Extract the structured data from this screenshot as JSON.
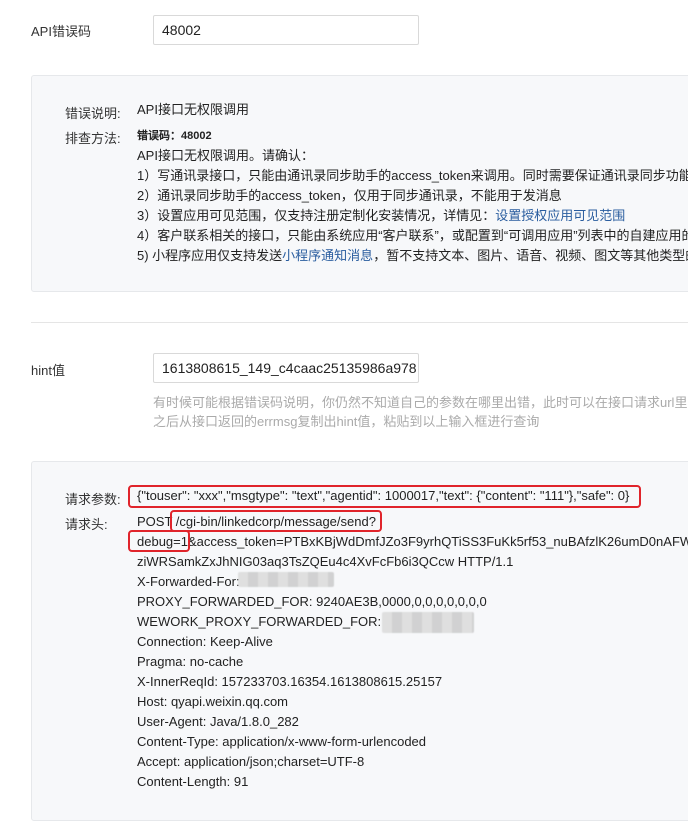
{
  "api_error": {
    "label": "API错误码",
    "value": "48002"
  },
  "error_panel": {
    "desc_label": "错误说明:",
    "desc_value": "API接口无权限调用",
    "check_label": "排查方法:",
    "code_line": "错误码：48002",
    "intro": "API接口无权限调用。请确认：",
    "items": [
      {
        "text": "1）写通讯录接口，只能由通讯录同步助手的access_token来调用。同时需要保证通讯录同步功能"
      },
      {
        "text": "2）通讯录同步助手的access_token，仅用于同步通讯录，不能用于发消息"
      },
      {
        "text_before": "3）设置应用可见范围，仅支持注册定制化安装情况，详情见：",
        "link": "设置授权应用可见范围"
      },
      {
        "text": "4）客户联系相关的接口，只能由系统应用“客户联系”，或配置到“可调用应用”列表中的自建应用的"
      },
      {
        "text_before": "5) 小程序应用仅支持发送",
        "link": "小程序通知消息",
        "text_after": "，暂不支持文本、图片、语音、视频、图文等其他类型的"
      }
    ]
  },
  "hint": {
    "label": "hint值",
    "value": "1613808615_149_c4caac25135986a978",
    "note_line1": "有时候可能根据错误码说明，你仍然不知道自己的参数在哪里出错，此时可以在接口请求url里",
    "note_line2": "之后从接口返回的errmsg复制出hint值，粘贴到以上输入框进行查询"
  },
  "request_panel": {
    "params_label": "请求参数:",
    "params_value": "{\"touser\": \"xxx\",\"msgtype\": \"text\",\"agentid\": 1000017,\"text\": {\"content\": \"111\"},\"safe\": 0}",
    "header_label": "请求头:",
    "header_lines": [
      {
        "text": "POST /cgi-bin/linkedcorp/message/send?"
      },
      {
        "text": "debug=1&access_token=PTBxKBjWdDmfJZo3F9yrhQTiSS3FuKk5rf53_nuBAfzlK26umD0nAFW"
      },
      {
        "text": "ziWRSamkZxJhNIG03aq3TsZQEu4c4XvFcFb6i3QCcw HTTP/1.1"
      },
      {
        "text": "X-Forwarded-For:"
      },
      {
        "text": "PROXY_FORWARDED_FOR: 9240AE3B,0000,0,0,0,0,0,0,0"
      },
      {
        "text": "WEWORK_PROXY_FORWARDED_FOR:"
      },
      {
        "text": "Connection: Keep-Alive"
      },
      {
        "text": "Pragma: no-cache"
      },
      {
        "text": "X-InnerReqId: 157233703.16354.1613808615.25157"
      },
      {
        "text": "Host: qyapi.weixin.qq.com"
      },
      {
        "text": "User-Agent: Java/1.8.0_282"
      },
      {
        "text": "Content-Type: application/x-www-form-urlencoded"
      },
      {
        "text": "Accept: application/json;charset=UTF-8"
      },
      {
        "text": "Content-Length: 91"
      }
    ]
  },
  "colors": {
    "link": "#2a5d9f",
    "annotation_red": "#e0242b",
    "panel_bg": "#f7f8fa"
  }
}
